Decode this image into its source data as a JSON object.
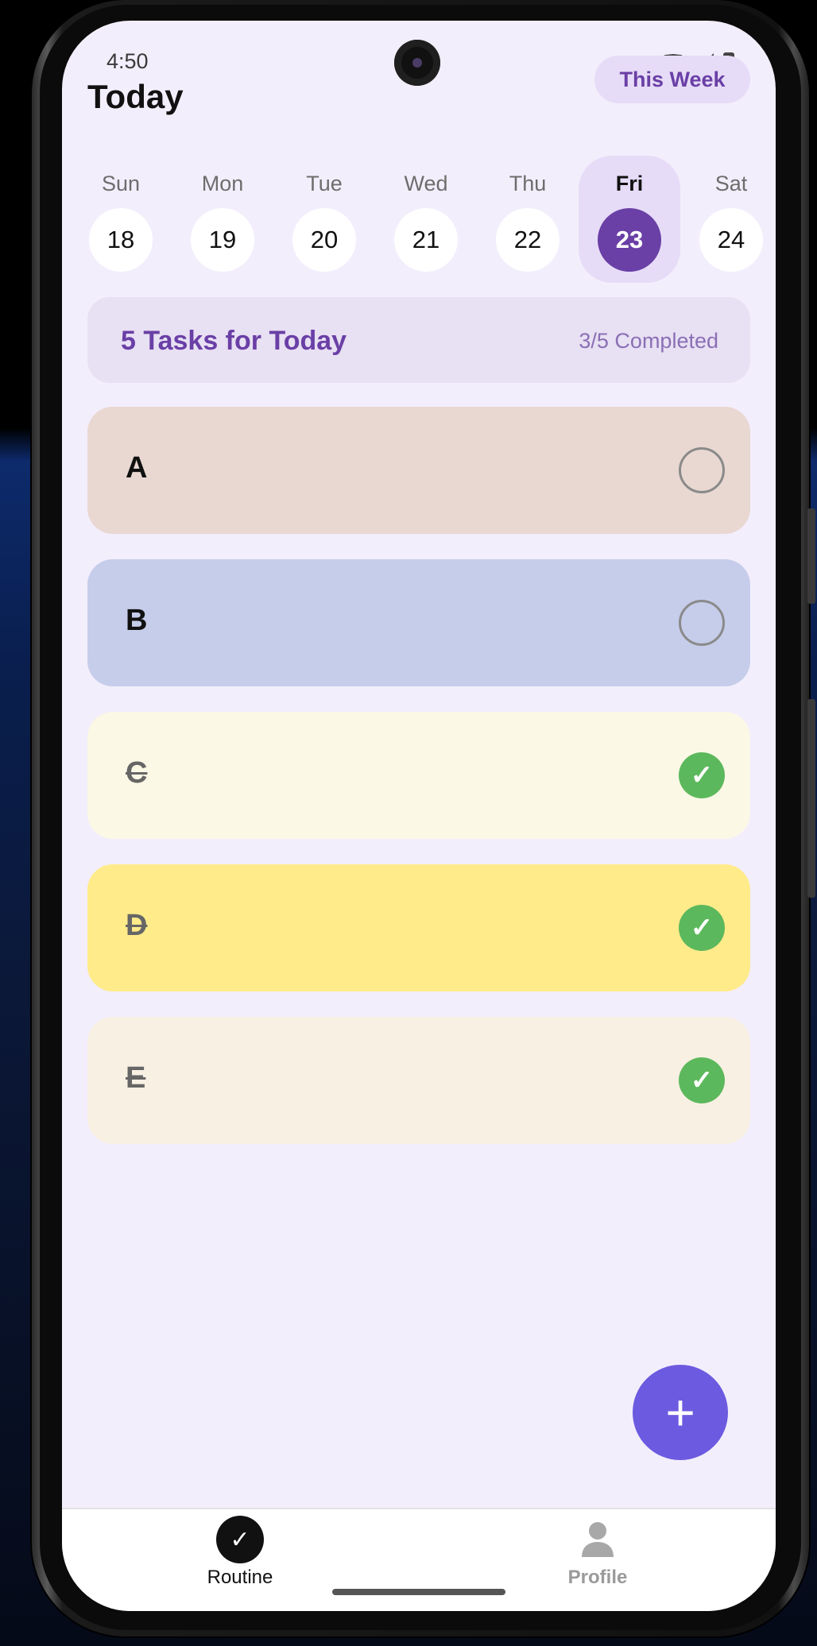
{
  "status": {
    "time": "4:50"
  },
  "header": {
    "title": "Today",
    "week_button": "This Week"
  },
  "days": [
    {
      "name": "Sun",
      "num": "18"
    },
    {
      "name": "Mon",
      "num": "19"
    },
    {
      "name": "Tue",
      "num": "20"
    },
    {
      "name": "Wed",
      "num": "21"
    },
    {
      "name": "Thu",
      "num": "22"
    },
    {
      "name": "Fri",
      "num": "23",
      "selected": true
    },
    {
      "name": "Sat",
      "num": "24"
    }
  ],
  "summary": {
    "title": "5 Tasks for Today",
    "count": "3/5 Completed"
  },
  "tasks": [
    {
      "label": "A",
      "done": false,
      "color": "#e9d7d1"
    },
    {
      "label": "B",
      "done": false,
      "color": "#c6cdea"
    },
    {
      "label": "C",
      "done": true,
      "color": "#fbf8e6"
    },
    {
      "label": "D",
      "done": true,
      "color": "#ffeb8a"
    },
    {
      "label": "E",
      "done": true,
      "color": "#f8f0e3"
    }
  ],
  "check_glyph": "✓",
  "fab": {
    "icon": "plus-icon",
    "glyph": "+"
  },
  "nav": {
    "routine": {
      "label": "Routine",
      "icon": "check-icon",
      "glyph": "✓"
    },
    "profile": {
      "label": "Profile",
      "icon": "person-icon"
    }
  },
  "colors": {
    "accent": "#6a3fa6",
    "fab": "#6c5ae0",
    "done": "#5cb85c",
    "background": "#f3eefc"
  }
}
